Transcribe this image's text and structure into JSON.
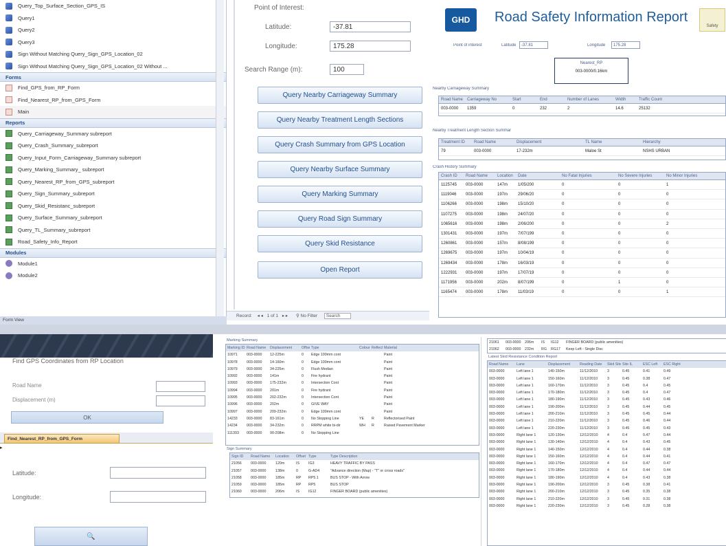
{
  "nav": {
    "top_queries": [
      "Query_Top_Surface_Section_GPS_IS",
      "Query1",
      "Query2",
      "Query3",
      "Sign Without Matching Query_Sign_GPS_Location_02",
      "Sign Without Matching Query_Sign_GPS_Location_02 Without ..."
    ],
    "forms_header": "Forms",
    "forms": [
      "Find_GPS_from_RP_Form",
      "Find_Nearest_RP_from_GPS_Form",
      "Main"
    ],
    "reports_header": "Reports",
    "reports": [
      "Query_Carriageway_Summary subreport",
      "Query_Crash_Summary_subreport",
      "Query_Input_Form_Carriageway_Summary subreport",
      "Query_Marking_Summary_ subreport",
      "Query_Nearest_RP_from_GPS_subreport",
      "Query_Sign_Summary_subreport",
      "Query_Skid_Resistanc_subreport",
      "Query_Surface_Summary_subreport",
      "Query_TL_Summary_subreport",
      "Road_Safety_Info_Report"
    ],
    "modules_header": "Modules",
    "modules": [
      "Module1",
      "Module2"
    ],
    "status": "Form View"
  },
  "main": {
    "poi_label": "Point of Interest:",
    "lat_label": "Latitude:",
    "lat_value": "-37.81",
    "lon_label": "Longitude:",
    "lon_value": "175.28",
    "range_label": "Search Range (m):",
    "range_value": "100",
    "buttons": [
      "Query Nearby Carriageway Summary",
      "Query Nearby Treatment Length Sections",
      "Query Crash Summary from GPS Location",
      "Query Nearby Surface Summary",
      "Query Marking Summary",
      "Query Road Sign Summary",
      "Query Skid Resistance",
      "Open Report"
    ],
    "recnav": {
      "record": "Record:",
      "pos": "1 of 1",
      "filter": "No Filter",
      "search": "Search"
    }
  },
  "report": {
    "logo": "GHD",
    "title": "Road Safety Information Report",
    "brand": "Safety",
    "poi": "Point of interest",
    "lat_label": "Latitude",
    "lat": "-37.81",
    "lon_label": "Longitude",
    "lon": "175.28",
    "nearest_label": "Nearest_RP",
    "nearest": "003-0000/0.16km",
    "carriage_title": "Nearby Carriageway Summary",
    "carriage_cols": [
      "Road Name",
      "Carriageway No",
      "Start",
      "End",
      "Number of Lanes",
      "Width",
      "Traffic Count"
    ],
    "carriage_row": [
      "003-0000",
      "1359",
      "0",
      "232",
      "2",
      "14.6",
      "25132"
    ],
    "tl_title": "Nearby Treatment Length Section Summar",
    "tl_cols": [
      "Treatment ID",
      "Road Name",
      "Displacement",
      "TL Name",
      "Hierarchy"
    ],
    "tl_row": [
      "79",
      "003-0000",
      "17-232m",
      "Maloe St",
      "NSHS URBAN"
    ],
    "crash_title": "Crash History Summary",
    "crash_cols": [
      "Crash ID",
      "Road Name",
      "Location",
      "Date",
      "No Fatal Injuries",
      "No Severe Injuries",
      "No Minor Injuries"
    ],
    "crash_rows": [
      [
        "1125745",
        "003-0000",
        "147m",
        "1/05/200",
        "0",
        "0",
        "1"
      ],
      [
        "1119046",
        "003-0000",
        "197m",
        "29/06/20",
        "0",
        "0",
        "0"
      ],
      [
        "1106266",
        "003-0000",
        "198m",
        "15/10/20",
        "0",
        "0",
        "0"
      ],
      [
        "1107275",
        "003-0000",
        "198m",
        "24/07/20",
        "0",
        "0",
        "0"
      ],
      [
        "1065616",
        "003-0000",
        "198m",
        "2/06/200",
        "0",
        "0",
        "2"
      ],
      [
        "1301431",
        "003-0000",
        "197m",
        "7/07/199",
        "0",
        "0",
        "0"
      ],
      [
        "1260861",
        "003-0000",
        "157m",
        "8/08/199",
        "0",
        "0",
        "0"
      ],
      [
        "1269675",
        "003-0000",
        "197m",
        "10/04/19",
        "0",
        "0",
        "0"
      ],
      [
        "1269434",
        "003-0000",
        "178m",
        "16/03/19",
        "0",
        "0",
        "0"
      ],
      [
        "1222931",
        "003-0000",
        "197m",
        "17/07/19",
        "0",
        "0",
        "0"
      ],
      [
        "1171956",
        "003-0000",
        "202m",
        "8/07/199",
        "0",
        "1",
        "0"
      ],
      [
        "1165474",
        "003-0000",
        "178m",
        "11/03/19",
        "0",
        "0",
        "1"
      ]
    ]
  },
  "gps": {
    "title": "Find GPS Coordinates from RP Location",
    "road_label": "Road Name",
    "disp_label": "Displacement (m)",
    "ok": "OK",
    "tab": "Find_Nearest_RP_from_GPS_Form",
    "lat_label": "Latitude:",
    "lon_label": "Longitude:",
    "search_btn": "🔍"
  },
  "marking": {
    "title": "Marking Summary",
    "cols": [
      "Marking ID",
      "Road Name",
      "Displacement",
      "Offset",
      "Type",
      "Colour",
      "Reflect?",
      "Material"
    ],
    "rows": [
      [
        "10971",
        "003-0000",
        "12-225m",
        "0",
        "Edge 100mm cont",
        "",
        "",
        "Paint"
      ],
      [
        "10978",
        "003-0000",
        "14-160m",
        "0",
        "Edge 100mm cont",
        "",
        "",
        "Paint"
      ],
      [
        "10979",
        "003-0000",
        "34-225m",
        "0",
        "Flush Median",
        "",
        "",
        "Paint"
      ],
      [
        "10992",
        "003-0000",
        "141m",
        "0",
        "Fire hydrant",
        "",
        "",
        "Paint"
      ],
      [
        "10993",
        "003-0000",
        "175-232m",
        "0",
        "Intersection Cont",
        "",
        "",
        "Paint"
      ],
      [
        "10994",
        "003-0000",
        "201m",
        "0",
        "Fire hydrant",
        "",
        "",
        "Paint"
      ],
      [
        "10995",
        "003-0000",
        "202-232m",
        "0",
        "Intersection Cont",
        "",
        "",
        "Paint"
      ],
      [
        "10996",
        "003-0000",
        "202m",
        "0",
        "GIVE WAY",
        "",
        "",
        "Paint"
      ],
      [
        "10997",
        "003-0000",
        "209-232m",
        "0",
        "Edge 100mm cont",
        "",
        "",
        "Paint"
      ],
      [
        "14233",
        "003-0000",
        "83-161m",
        "0",
        "No Stopping Line",
        "YE",
        "R",
        "Reflectorised Paint"
      ],
      [
        "14234",
        "003-0000",
        "34-232m",
        "0",
        "RRPM white bi-dir",
        "WH",
        "R",
        "Raised Pavement Marker"
      ],
      [
        "111393",
        "003-0000",
        "90-208m",
        "0",
        "No Stopping Line",
        "",
        "",
        ""
      ]
    ],
    "sign_title": "Sign Summary",
    "sign_cols": [
      "Sign ID",
      "Road Name",
      "Location",
      "Offset",
      "Type",
      "Type Description"
    ],
    "sign_rows": [
      [
        "21056",
        "003-0000",
        "120m",
        "IS",
        "IG3",
        "HEAVY TRAFFIC BY PASS"
      ],
      [
        "21057",
        "003-0000",
        "138m",
        "0",
        "G-AD4",
        "\"Advance direction (Map) - \"T\" or cross roads\""
      ],
      [
        "21058",
        "003-0000",
        "185m",
        "RP",
        "RP5.1",
        "BUS STOP - With Arrow"
      ],
      [
        "21059",
        "003-0000",
        "185m",
        "RP",
        "RP5",
        "BUS STOP"
      ],
      [
        "21060",
        "003-0000",
        "206m",
        "IS",
        "IG12",
        "FINGER BOARD (public amenities)"
      ]
    ]
  },
  "skid": {
    "top_rows": [
      [
        "21061",
        "003-0000",
        "206m",
        "IS",
        "IG12",
        "FINGER BOARD (public amenities)"
      ],
      [
        "21062",
        "003-0000",
        "232m",
        "RG",
        "RG17",
        "Keep Left - Single Disc"
      ]
    ],
    "title": "Latest Skid Resistance Condition Report",
    "cols": [
      "Road Name",
      "Lane",
      "Displacement",
      "Reading Date",
      "Skid Site",
      "Site IL",
      "ESC Left",
      "ESC Right"
    ],
    "rows": [
      [
        "003-0000",
        "Left lane 1",
        "140-150m",
        "11/12/2010",
        "3",
        "0.45",
        "0.41",
        "0.49"
      ],
      [
        "003-0000",
        "Left lane 1",
        "150-160m",
        "11/12/2010",
        "3",
        "0.45",
        "0.38",
        "0.47"
      ],
      [
        "003-0000",
        "Left lane 1",
        "160-170m",
        "11/12/2010",
        "3",
        "0.45",
        "0.4",
        "0.45"
      ],
      [
        "003-0000",
        "Left lane 1",
        "170-180m",
        "11/12/2010",
        "3",
        "0.45",
        "0.4",
        "0.47"
      ],
      [
        "003-0000",
        "Left lane 1",
        "180-190m",
        "11/12/2010",
        "3",
        "0.45",
        "0.43",
        "0.46"
      ],
      [
        "003-0000",
        "Left lane 1",
        "190-200m",
        "11/12/2010",
        "3",
        "0.45",
        "0.44",
        "0.45"
      ],
      [
        "003-0000",
        "Left lane 1",
        "200-210m",
        "11/12/2010",
        "3",
        "0.45",
        "0.45",
        "0.44"
      ],
      [
        "003-0000",
        "Left lane 1",
        "210-220m",
        "11/12/2010",
        "3",
        "0.45",
        "0.46",
        "0.44"
      ],
      [
        "003-0000",
        "Left lane 1",
        "220-230m",
        "11/12/2010",
        "3",
        "0.45",
        "0.45",
        "0.43"
      ],
      [
        "003-0000",
        "Right lane 1",
        "120-130m",
        "12/12/2010",
        "4",
        "0.4",
        "0.47",
        "0.44"
      ],
      [
        "003-0000",
        "Right lane 1",
        "130-140m",
        "12/12/2010",
        "4",
        "0.4",
        "0.43",
        "0.45"
      ],
      [
        "003-0000",
        "Right lane 1",
        "140-150m",
        "12/12/2010",
        "4",
        "0.4",
        "0.44",
        "0.38"
      ],
      [
        "003-0000",
        "Right lane 1",
        "150-160m",
        "12/12/2010",
        "4",
        "0.4",
        "0.44",
        "0.41"
      ],
      [
        "003-0000",
        "Right lane 1",
        "160-170m",
        "12/12/2010",
        "4",
        "0.4",
        "0.47",
        "0.47"
      ],
      [
        "003-0000",
        "Right lane 1",
        "170-180m",
        "12/12/2010",
        "4",
        "0.4",
        "0.44",
        "0.44"
      ],
      [
        "003-0000",
        "Right lane 1",
        "180-190m",
        "12/12/2010",
        "4",
        "0.4",
        "0.43",
        "0.38"
      ],
      [
        "003-0000",
        "Right lane 1",
        "190-200m",
        "12/12/2010",
        "3",
        "0.45",
        "0.38",
        "0.41"
      ],
      [
        "003-0000",
        "Right lane 1",
        "200-210m",
        "12/12/2010",
        "3",
        "0.45",
        "0.35",
        "0.38"
      ],
      [
        "003-0000",
        "Right lane 1",
        "210-220m",
        "12/12/2010",
        "3",
        "0.45",
        "0.31",
        "0.38"
      ],
      [
        "003-0000",
        "Right lane 1",
        "220-230m",
        "12/12/2010",
        "3",
        "0.45",
        "0.28",
        "0.38"
      ]
    ]
  }
}
